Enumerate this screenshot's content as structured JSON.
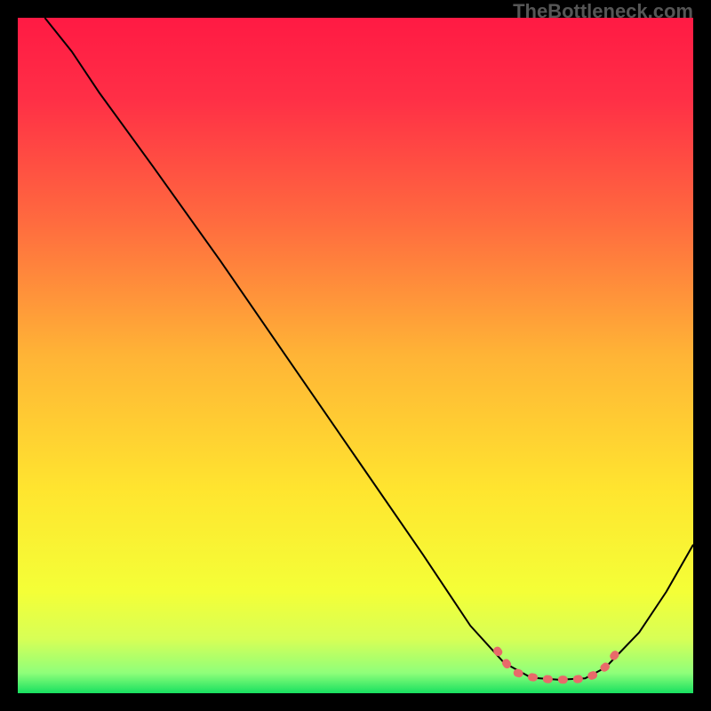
{
  "watermark": "TheBottleneck.com",
  "chart_data": {
    "type": "line",
    "title": "",
    "xlabel": "",
    "ylabel": "",
    "xlim": [
      0,
      100
    ],
    "ylim": [
      0,
      100
    ],
    "gradient_stops": [
      {
        "pos": 0.0,
        "color": "#ff1a44"
      },
      {
        "pos": 0.12,
        "color": "#ff2f46"
      },
      {
        "pos": 0.3,
        "color": "#ff6a3f"
      },
      {
        "pos": 0.5,
        "color": "#ffb436"
      },
      {
        "pos": 0.7,
        "color": "#ffe52f"
      },
      {
        "pos": 0.85,
        "color": "#f4ff37"
      },
      {
        "pos": 0.92,
        "color": "#d7ff56"
      },
      {
        "pos": 0.97,
        "color": "#8fff7a"
      },
      {
        "pos": 1.0,
        "color": "#18e060"
      }
    ],
    "series": [
      {
        "name": "bottleneck-curve",
        "stroke": "#000000",
        "x": [
          4,
          8,
          12,
          20,
          30,
          40,
          50,
          60,
          67,
          72,
          76,
          80,
          84,
          87,
          92,
          96,
          100
        ],
        "y": [
          100,
          95,
          89,
          78,
          64,
          49.5,
          35,
          20.5,
          10,
          4.5,
          2.3,
          2.0,
          2.2,
          3.8,
          9,
          15,
          22
        ]
      },
      {
        "name": "optimal-range-marker",
        "stroke": "#e86a6a",
        "x": [
          71,
          72.5,
          74,
          76,
          78,
          80,
          82,
          84,
          85.5,
          87,
          88.5
        ],
        "y": [
          6.3,
          4.2,
          3.0,
          2.4,
          2.1,
          2.0,
          2.0,
          2.2,
          2.8,
          3.9,
          5.8
        ]
      }
    ]
  }
}
